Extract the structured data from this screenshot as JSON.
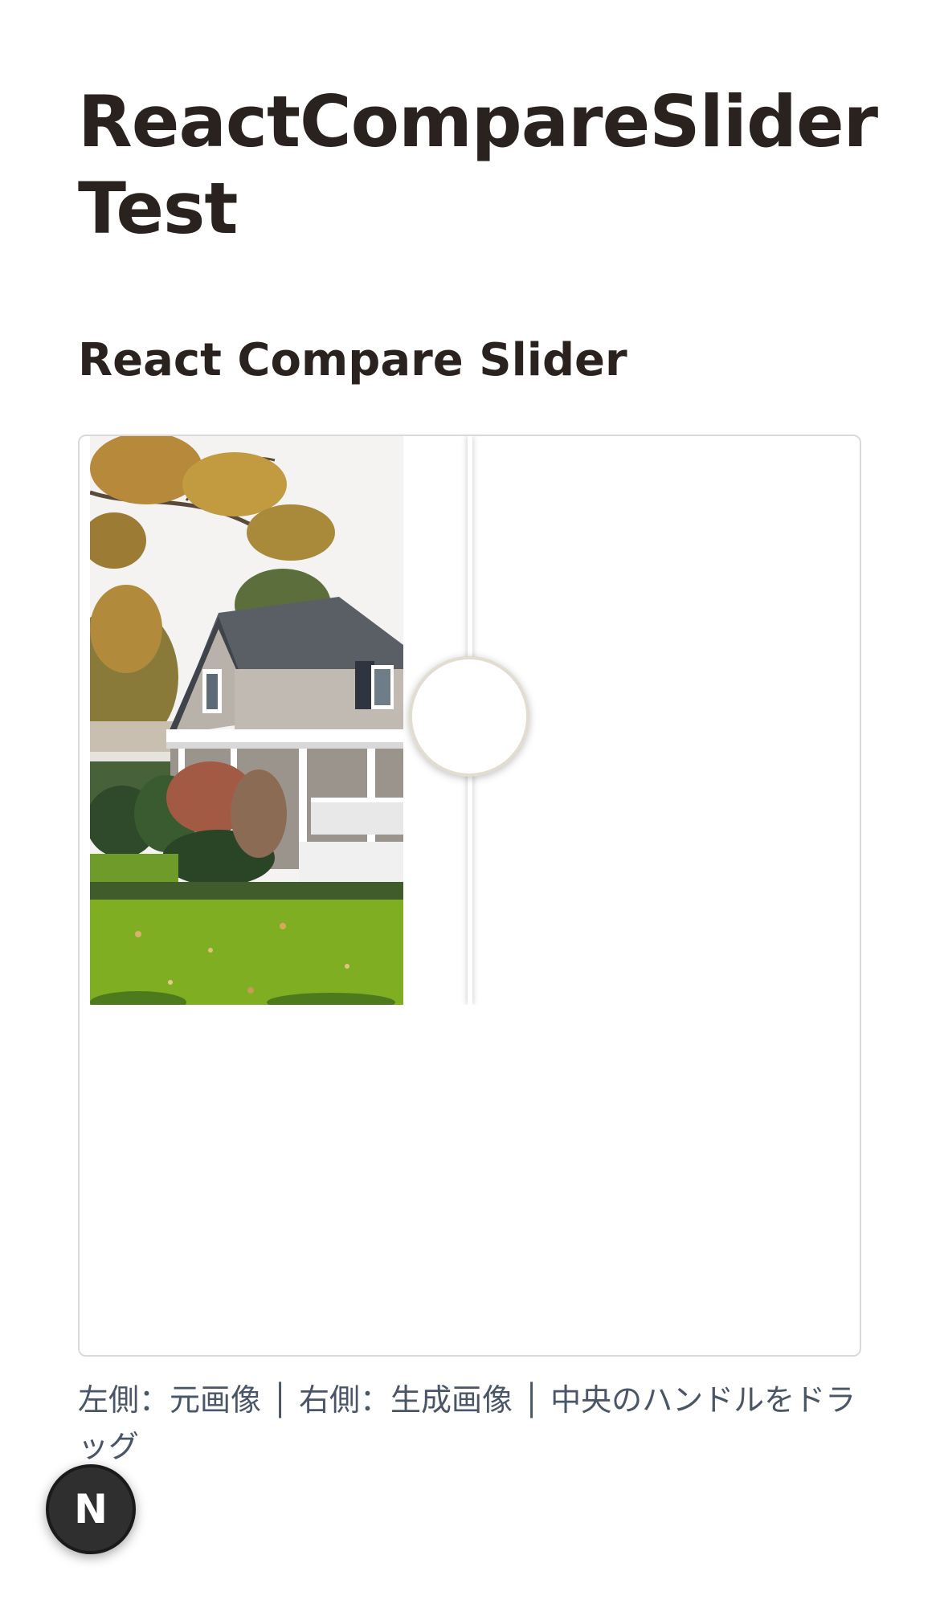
{
  "header": {
    "title": "ReactCompareSlider Test"
  },
  "section": {
    "title": "React Compare Slider"
  },
  "slider": {
    "handle_position": 0.48,
    "left_image": "house-photo",
    "right_image": "blank-generated"
  },
  "caption": {
    "text": "左側：元画像 │ 右側：生成画像 │ 中央のハンドルをドラッグ"
  },
  "dev_badge": {
    "label": "N",
    "icon": "nextjs-logo-icon"
  },
  "colors": {
    "heading": "#2a221e",
    "caption": "#4a5568",
    "frame_border": "#d9d9dd",
    "handle_border": "#e2ddd0",
    "badge_bg": "#2f2f2f"
  }
}
